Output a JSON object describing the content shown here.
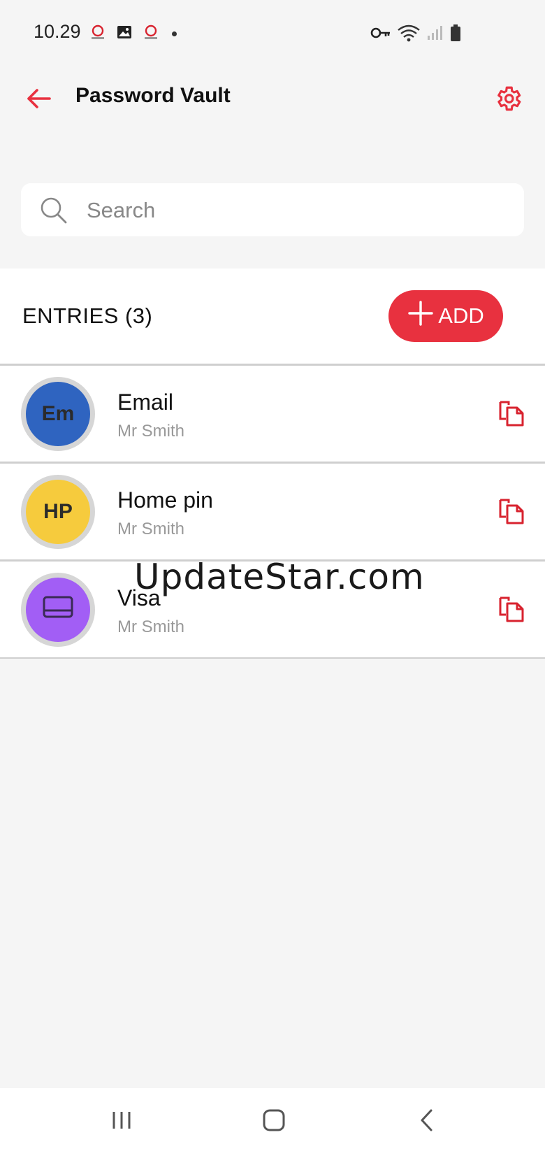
{
  "status_bar": {
    "time": "10.29",
    "icons": [
      "secure-icon",
      "image-icon",
      "secure-icon",
      "dot",
      "key-icon",
      "wifi-icon",
      "signal-icon",
      "battery-icon"
    ]
  },
  "app_bar": {
    "title": "Password Vault",
    "back_icon": "arrow-left-icon",
    "settings_icon": "gear-icon"
  },
  "search": {
    "placeholder": "Search",
    "value": ""
  },
  "entries": {
    "header": "ENTRIES (3)",
    "add_label": "ADD",
    "items": [
      {
        "initials": "Em",
        "name": "Email",
        "user": "Mr Smith",
        "color": "#2f64c0",
        "icon": ""
      },
      {
        "initials": "HP",
        "name": "Home pin",
        "user": "Mr Smith",
        "color": "#f6cb3d",
        "icon": ""
      },
      {
        "initials": "",
        "name": "Visa",
        "user": "Mr Smith",
        "color": "#a25ef5",
        "icon": "card-icon"
      }
    ]
  },
  "watermark": "UpdateStar.com",
  "nav_bar": {
    "recents_icon": "recents-icon",
    "home_icon": "home-icon",
    "back_icon": "back-chevron-icon"
  },
  "colors": {
    "accent": "#e8313f",
    "background": "#f5f5f5",
    "surface": "#ffffff"
  }
}
